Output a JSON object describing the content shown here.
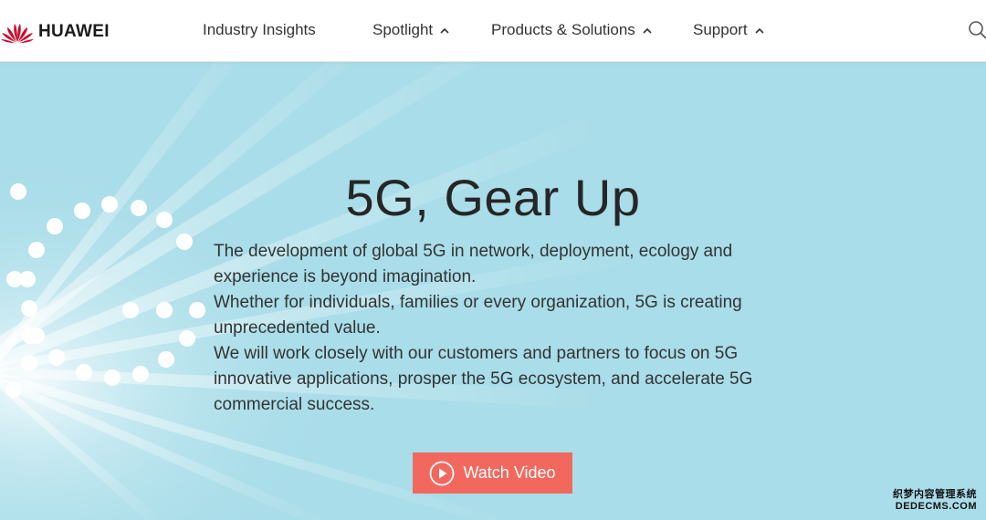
{
  "header": {
    "brand": "HUAWEI",
    "nav": [
      {
        "label": "Industry Insights"
      },
      {
        "label": "Spotlight"
      },
      {
        "label": "Products & Solutions"
      },
      {
        "label": "Support"
      }
    ]
  },
  "hero": {
    "title": "5G, Gear Up",
    "paragraphs": [
      "The development of global 5G in network, deployment, ecology and experience is beyond imagination.",
      "Whether for individuals, families or every organization, 5G is creating unprecedented value.",
      "We will work closely with our customers and partners to focus on 5G innovative applications, prosper the 5G ecosystem, and accelerate 5G commercial success."
    ],
    "button_label": "Watch Video"
  },
  "watermark": {
    "line1": "织梦内容管理系统",
    "line2": "DEDECMS.COM"
  },
  "colors": {
    "brand_red": "#cf0a2c",
    "hero_bg": "#a9dde9",
    "button": "#f2685e"
  },
  "icons": {
    "search": "search-icon",
    "chevron": "chevron-up-icon",
    "play": "play-circle-icon"
  }
}
